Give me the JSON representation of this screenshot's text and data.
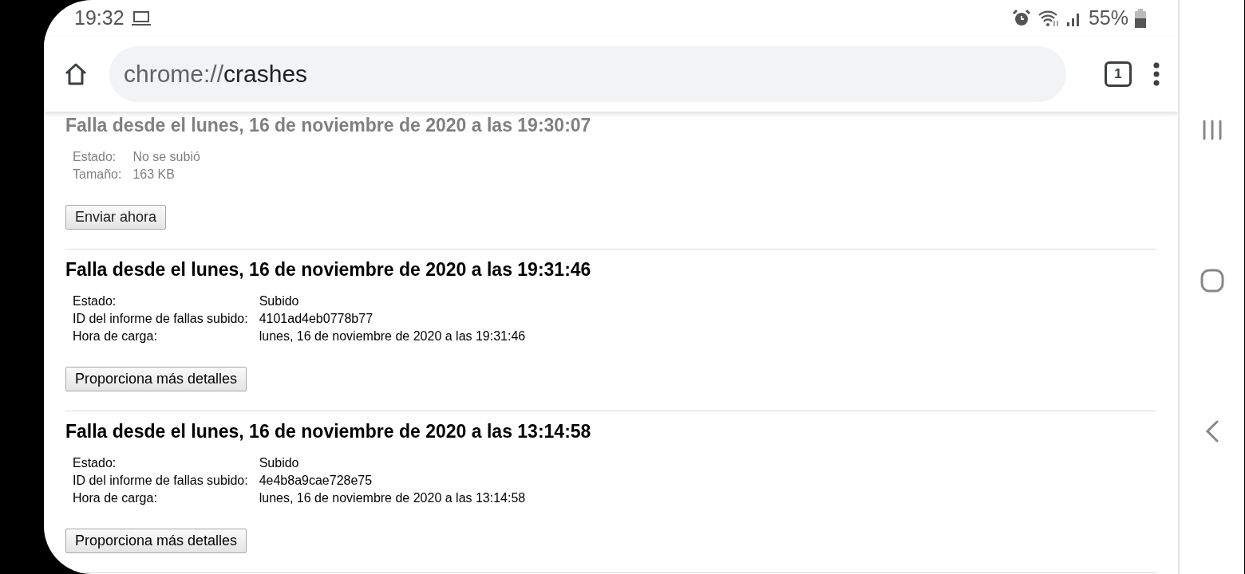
{
  "status_bar": {
    "time": "19:32",
    "battery_text": "55%"
  },
  "toolbar": {
    "url_scheme": "chrome://",
    "url_path": "crashes",
    "tab_count": "1"
  },
  "crashes": [
    {
      "dimmed": true,
      "title": "Falla desde el lunes, 16 de noviembre de 2020 a las 19:30:07",
      "details": [
        {
          "label": "Estado:",
          "value": "No se subió"
        },
        {
          "label": "Tamaño:",
          "value": "163 KB"
        }
      ],
      "button": "Enviar ahora"
    },
    {
      "dimmed": false,
      "title": "Falla desde el lunes, 16 de noviembre de 2020 a las 19:31:46",
      "details": [
        {
          "label": "Estado:",
          "value": "Subido"
        },
        {
          "label": "ID del informe de fallas subido:",
          "value": "4101ad4eb0778b77"
        },
        {
          "label": "Hora de carga:",
          "value": "lunes, 16 de noviembre de 2020 a las 19:31:46"
        }
      ],
      "button": "Proporciona más detalles"
    },
    {
      "dimmed": false,
      "title": "Falla desde el lunes, 16 de noviembre de 2020 a las 13:14:58",
      "details": [
        {
          "label": "Estado:",
          "value": "Subido"
        },
        {
          "label": "ID del informe de fallas subido:",
          "value": "4e4b8a9cae728e75"
        },
        {
          "label": "Hora de carga:",
          "value": "lunes, 16 de noviembre de 2020 a las 13:14:58"
        }
      ],
      "button": "Proporciona más detalles"
    }
  ]
}
